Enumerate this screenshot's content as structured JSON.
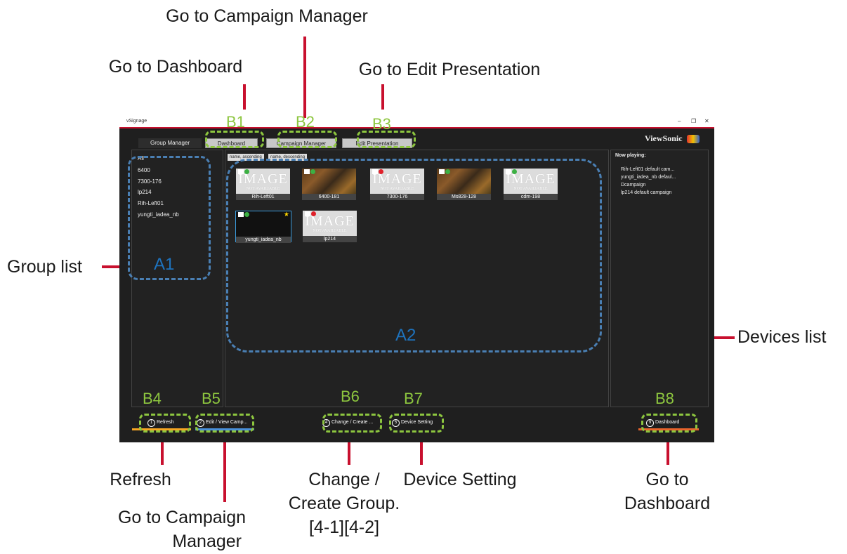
{
  "annotations": {
    "go_campaign_manager_top": "Go to Campaign Manager",
    "go_dashboard_top": "Go to Dashboard",
    "go_edit_presentation": "Go to Edit Presentation",
    "group_list": "Group list",
    "devices_list": "Devices list",
    "refresh": "Refresh",
    "go_campaign_manager_bottom_1": "Go to Campaign",
    "go_campaign_manager_bottom_2": "Manager",
    "change_create_1": "Change /",
    "change_create_2": "Create Group.",
    "change_create_3": "[4-1][4-2]",
    "device_setting": "Device Setting",
    "go_dashboard_bottom_1": "Go to",
    "go_dashboard_bottom_2": "Dashboard"
  },
  "tags": {
    "a1": "A1",
    "a2": "A2",
    "b1": "B1",
    "b2": "B2",
    "b3": "B3",
    "b4": "B4",
    "b5": "B5",
    "b6": "B6",
    "b7": "B7",
    "b8": "B8"
  },
  "window": {
    "title": "vSignage",
    "minimize": "–",
    "restore": "❐",
    "close": "✕",
    "logo": "ViewSonic"
  },
  "tabs": [
    {
      "label": "Group Manager"
    },
    {
      "label": "Dashboard"
    },
    {
      "label": "Campaign Manager"
    },
    {
      "label": "Edit Presentation"
    }
  ],
  "groups": [
    "All",
    "6400",
    "7300-176",
    "lp214",
    "Rih-Left01",
    "yungti_iadea_nb"
  ],
  "sort": {
    "ascending": "name, ascending",
    "descending": "name, descending"
  },
  "devices": [
    {
      "name": "Rih-Left01",
      "image": "placeholder",
      "status": "green"
    },
    {
      "name": "6400-181",
      "image": "food",
      "status": "green"
    },
    {
      "name": "7300-176",
      "image": "placeholder",
      "status": "red"
    },
    {
      "name": "Ms828-128",
      "image": "food",
      "status": "green"
    },
    {
      "name": "cdm-198",
      "image": "placeholder",
      "status": "green"
    },
    {
      "name": "yungti_iadea_nb",
      "image": "black",
      "status": "green"
    },
    {
      "name": "lp214",
      "image": "placeholder",
      "status": "red"
    }
  ],
  "placeholder": {
    "big": "IMAGE",
    "small": "NOT AVAILIABLE"
  },
  "now_playing": {
    "title": "Now playing:",
    "items": [
      "Rih-Left01 default cam...",
      "yungti_iadea_nb defaul...",
      "Dcampaign",
      "lp214 default campaign"
    ]
  },
  "bottom_buttons": [
    {
      "num": "1",
      "label": "Refresh"
    },
    {
      "num": "2",
      "label": "Edit / View Camp..."
    },
    {
      "num": "4",
      "label": "Change / Create ..."
    },
    {
      "num": "5",
      "label": "Device Setting"
    },
    {
      "num": "9",
      "label": "Dashboard"
    }
  ],
  "colors": {
    "accent": "#c8102e",
    "tag_green": "#8dc63f",
    "tag_blue": "#1e73be",
    "status_green": "#3cb043",
    "status_red": "#e0202a"
  }
}
